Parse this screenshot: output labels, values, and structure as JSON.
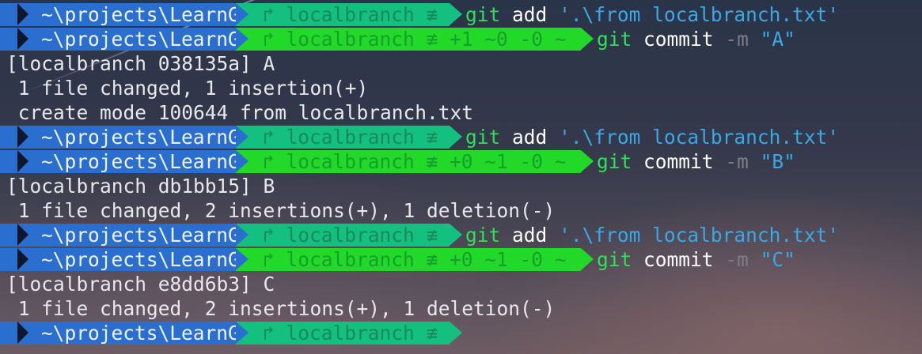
{
  "prompt": {
    "path": "~\\projects\\LearnGit",
    "git_clean": "↱ localbranch ≢",
    "git_dirty_1": "↱ localbranch ≢ +1 ~0 -0 ~",
    "git_dirty_2": "↱ localbranch ≢ +0 ~1 -0 ~"
  },
  "commands": {
    "git": "git",
    "add": "add",
    "add_arg": "'.\\from localbranch.txt'",
    "commit": "commit",
    "flag": "-m",
    "msg_a": "\"A\"",
    "msg_b": "\"B\"",
    "msg_c": "\"C\""
  },
  "output": {
    "commit_a": "[localbranch 038135a] A",
    "stat_a": " 1 file changed, 1 insertion(+)",
    "create_a": " create mode 100644 from localbranch.txt",
    "commit_b": "[localbranch db1bb15] B",
    "stat_b": " 1 file changed, 2 insertions(+), 1 deletion(-)",
    "commit_c": "[localbranch e8dd6b3] C",
    "stat_c": " 1 file changed, 2 insertions(+), 1 deletion(-)"
  },
  "colors": {
    "path_segment": "#2a6fcf",
    "git_clean_segment": "#14c080",
    "git_dirty_segment": "#22d92a",
    "git_command": "#2ee05a",
    "string_arg": "#3aa8e6",
    "flag": "#7d7d88"
  }
}
